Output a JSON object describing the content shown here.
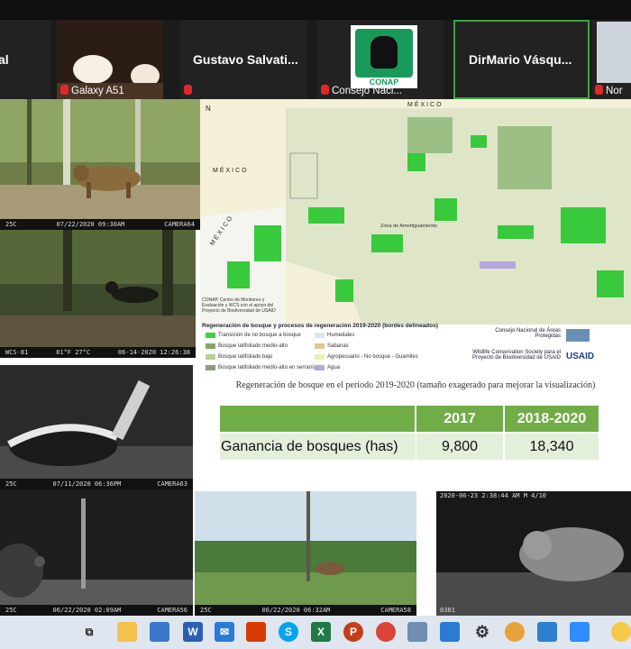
{
  "participants": [
    {
      "name": "al",
      "sub": ""
    },
    {
      "name": "",
      "sub": "Galaxy A51"
    },
    {
      "name": "Gustavo  Salvati...",
      "sub": ""
    },
    {
      "name": "",
      "sub": "Consejo Naci..."
    },
    {
      "name": "DirMario  Vásqu...",
      "sub": ""
    },
    {
      "name": "",
      "sub": "Nor"
    }
  ],
  "logo_text": "CONAP",
  "camera_stamps": [
    {
      "left": "25C",
      "mid": "07/22/2020  09:30AM",
      "right": "CAMERA64"
    },
    {
      "left": "WCS-81",
      "mid": "81°F 27°C",
      "right": "06-14-2020   12:26:38"
    },
    {
      "left": "25C",
      "mid": "07/11/2020  06:36PM",
      "right": "CAMERA63"
    },
    {
      "left": "25C",
      "mid": "06/22/2020  02:09AM",
      "right": "CAMERA56"
    },
    {
      "left": "25C",
      "mid": "06/22/2020  06:32AM",
      "right": "CAMERA58"
    },
    {
      "top": "2020-06-23  2:38:44 AM  M 4/10",
      "bottom": "0381"
    }
  ],
  "map": {
    "north": "N",
    "country_top": "MÉXICO",
    "country_left": "MÉXICO",
    "country_diag": "MÉXICO",
    "zone_label": "Zona de Amortiguamiento",
    "credit": "CONAP, Centro de Monitoreo y Evaluación y WCS con el apoyo del Proyecto de Biodiversidad de USAID",
    "legend_title": "Regeneración de bosque y procesos de regeneración 2019-2020 (bordes delineados)",
    "legend_items": [
      {
        "label": "Transición de no bosque a bosque",
        "color": "#3fd23f"
      },
      {
        "label": "Humedales",
        "color": "#d9e8ea"
      },
      {
        "label": "Bosque latifoliado medio-alto",
        "color": "#7fa86a"
      },
      {
        "label": "Sabanas",
        "color": "#e2c98c"
      },
      {
        "label": "Bosque latifoliado bajo",
        "color": "#b7cf9a"
      },
      {
        "label": "Agropecuario - No bosque - Guamiles",
        "color": "#f2ecb5"
      },
      {
        "label": "Bosque latifoliado medio-alto en serranía",
        "color": "#8c9a7e"
      },
      {
        "label": "Agua",
        "color": "#b5a6e0"
      }
    ],
    "orgs": [
      "Consejo Nacional de Áreas Protegidas",
      "Wildlife Conservation Society para el Proyecto de Biodiversidad de USAID"
    ],
    "usaid": "USAID"
  },
  "table": {
    "title": "Regeneración de bosque en el periodo 2019-2020 (tamaño exagerado para mejorar la visualización)",
    "headers": [
      "",
      "2017",
      "2018-2020"
    ],
    "rows": [
      {
        "label": "Ganancia de bosques (has)",
        "v2017": "9,800",
        "v2018": "18,340"
      }
    ]
  },
  "taskbar_apps": [
    "task-view",
    "file-explorer",
    "store",
    "word",
    "mail",
    "office",
    "skype",
    "excel",
    "powerpoint",
    "chrome",
    "laptop",
    "calendar",
    "settings",
    "chrome-profile",
    "photos",
    "zoom",
    "notes"
  ],
  "colors": {
    "table_header": "#70ad47",
    "table_row": "#e2efda",
    "mic_muted": "#e02828"
  }
}
